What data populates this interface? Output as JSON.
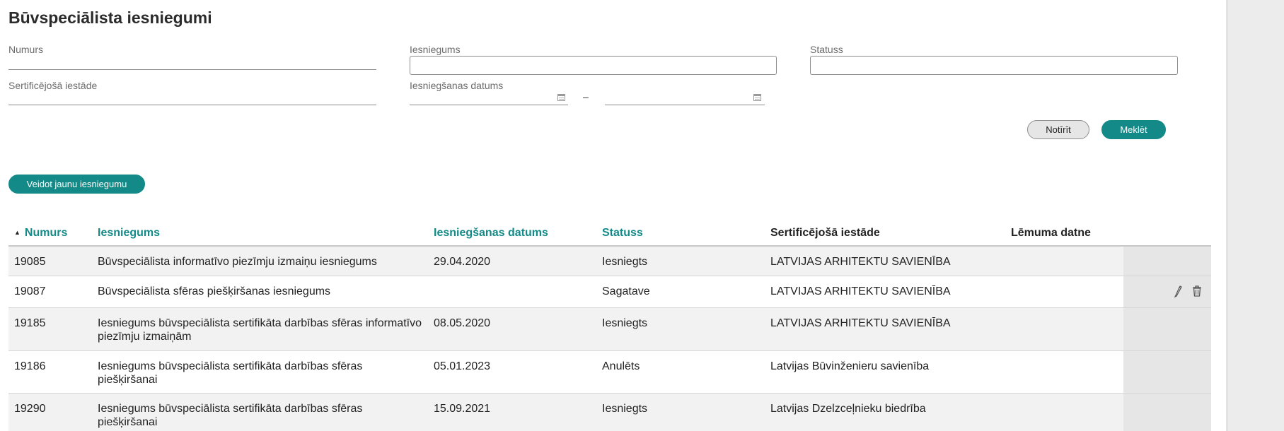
{
  "page": {
    "title": "Būvspeciālista iesniegumi"
  },
  "filters": {
    "numurs_label": "Numurs",
    "numurs_value": "",
    "iesniegums_label": "Iesniegums",
    "iesniegums_value": "",
    "statuss_label": "Statuss",
    "statuss_value": "",
    "iestade_label": "Sertificējošā iestāde",
    "iestade_value": "",
    "datums_label": "Iesniegšanas datums",
    "date_from": "",
    "date_to": "",
    "range_separator": "–"
  },
  "buttons": {
    "clear": "Notīrīt",
    "search": "Meklēt",
    "create": "Veidot jaunu iesniegumu"
  },
  "table": {
    "sort_indicator": "▲",
    "headers": {
      "numurs": "Numurs",
      "iesniegums": "Iesniegums",
      "datums": "Iesniegšanas datums",
      "statuss": "Statuss",
      "iestade": "Sertificējošā iestāde",
      "lemums": "Lēmuma datne"
    },
    "rows": [
      {
        "numurs": "19085",
        "iesniegums": "Būvspeciālista informatīvo piezīmju izmaiņu iesniegums",
        "datums": "29.04.2020",
        "statuss": "Iesniegts",
        "iestade": "LATVIJAS ARHITEKTU SAVIENĪBA",
        "lemums": ""
      },
      {
        "numurs": "19087",
        "iesniegums": "Būvspeciālista sfēras piešķiršanas iesniegums",
        "datums": "",
        "statuss": "Sagatave",
        "iestade": "LATVIJAS ARHITEKTU SAVIENĪBA",
        "lemums": ""
      },
      {
        "numurs": "19185",
        "iesniegums": "Iesniegums būvspeciālista sertifikāta darbības sfēras informatīvo piezīmju izmaiņām",
        "datums": "08.05.2020",
        "statuss": "Iesniegts",
        "iestade": "LATVIJAS ARHITEKTU SAVIENĪBA",
        "lemums": ""
      },
      {
        "numurs": "19186",
        "iesniegums": "Iesniegums būvspeciālista sertifikāta darbības sfēras piešķiršanai",
        "datums": "05.01.2023",
        "statuss": "Anulēts",
        "iestade": "Latvijas Būvinženieru savienība",
        "lemums": ""
      },
      {
        "numurs": "19290",
        "iesniegums": "Iesniegums būvspeciālista sertifikāta darbības sfēras piešķiršanai",
        "datums": "15.09.2021",
        "statuss": "Iesniegts",
        "iestade": "Latvijas Dzelzceļnieku biedrība",
        "lemums": ""
      }
    ]
  },
  "colors": {
    "accent": "#138a87",
    "row_shade": "#f2f2f2",
    "action_column": "#e6e6e6"
  },
  "icons": {
    "date_picker": "calendar-icon",
    "edit": "pencil-icon",
    "delete": "trash-icon",
    "sort": "sort-ascending-icon"
  }
}
